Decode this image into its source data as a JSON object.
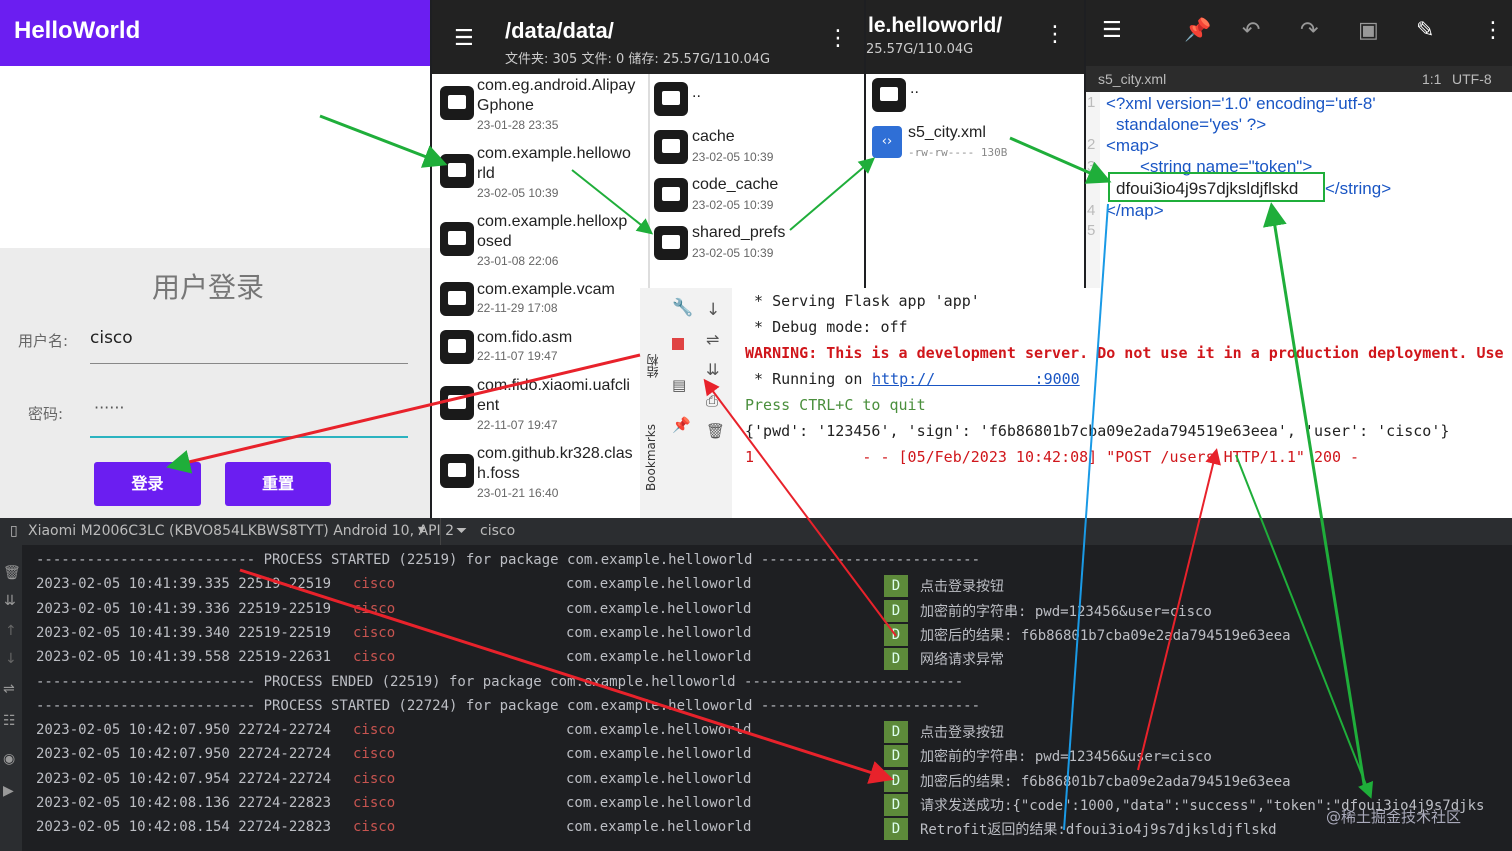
{
  "app": {
    "title": "HelloWorld",
    "login_title": "用户登录",
    "username_label": "用户名:",
    "username_value": "cisco",
    "password_label": "密码:",
    "password_value": "······",
    "login_button": "登录",
    "reset_button": "重置"
  },
  "fm": {
    "path": "/data/data/",
    "stats": "文件夹: 305  文件: 0  储存: 25.57G/110.04G",
    "items": [
      {
        "name1": "com.eg.android.Alipay",
        "name2": "Gphone",
        "date": "23-01-28 23:35"
      },
      {
        "name1": "com.example.hellowo",
        "name2": "rld",
        "date": "23-02-05 10:39"
      },
      {
        "name1": "com.example.helloxp",
        "name2": "osed",
        "date": "23-01-08 22:06"
      },
      {
        "name1": "com.example.vcam",
        "name2": "",
        "date": "22-11-29 17:08"
      },
      {
        "name1": "com.fido.asm",
        "name2": "",
        "date": "22-11-07 19:47"
      },
      {
        "name1": "com.fido.xiaomi.uafcli",
        "name2": "ent",
        "date": "22-11-07 19:47"
      },
      {
        "name1": "com.github.kr328.clas",
        "name2": "h.foss",
        "date": "23-01-21 16:40"
      }
    ],
    "dirs": [
      {
        "name": "..",
        "date": ""
      },
      {
        "name": "cache",
        "date": "23-02-05 10:39"
      },
      {
        "name": "code_cache",
        "date": "23-02-05 10:39"
      },
      {
        "name": "shared_prefs",
        "date": "23-02-05 10:39"
      }
    ]
  },
  "fm2": {
    "path": "le.helloworld/",
    "stats": "25.57G/110.04G",
    "up": "..",
    "file": "s5_city.xml",
    "file_meta": "-rw-rw----  130B"
  },
  "editor": {
    "filename": "s5_city.xml",
    "pos": "1:1",
    "encoding": "UTF-8",
    "lines": [
      "<?xml version='1.0' encoding='utf-8'",
      "standalone='yes' ?>",
      "<map>",
      "<string name=\"token\">",
      "dfoui3io4j9s7djksldjflskd",
      "</string>",
      "</map>"
    ],
    "line_numbers": [
      "1",
      "2",
      "3",
      "4",
      "5"
    ]
  },
  "terminal": {
    "lines": [
      " * Serving Flask app 'app'",
      " * Debug mode: off",
      "WARNING: This is a development server. Do not use it in a production deployment. Use",
      " * Running on ",
      "Press CTRL+C to quit",
      "{'pwd': '123456', 'sign': 'f6b86801b7cba09e2ada794519e63eea', 'user': 'cisco'}",
      "1            - - [05/Feb/2023 10:42:08] \"POST /users HTTP/1.1\" 200 -"
    ],
    "link": "http://           :9000",
    "side_labels": [
      "结构",
      "Bookmarks"
    ]
  },
  "logcat": {
    "device": "Xiaomi M2006C3LC (KBVO854LKBWS8TYT) Android 10, API 2",
    "filter": "cisco",
    "lines": [
      {
        "text": "-------------------------- PROCESS STARTED (22519) for package com.example.helloworld --------------------------",
        "kind": "sep"
      },
      {
        "ts": "2023-02-05 10:41:39.335 22519-22519",
        "tag": "cisco",
        "pkg": "com.example.helloworld",
        "lvl": "D",
        "msg": "点击登录按钮"
      },
      {
        "ts": "2023-02-05 10:41:39.336 22519-22519",
        "tag": "cisco",
        "pkg": "com.example.helloworld",
        "lvl": "D",
        "msg": "加密前的字符串: pwd=123456&user=cisco"
      },
      {
        "ts": "2023-02-05 10:41:39.340 22519-22519",
        "tag": "cisco",
        "pkg": "com.example.helloworld",
        "lvl": "D",
        "msg": "加密后的结果: f6b86801b7cba09e2ada794519e63eea"
      },
      {
        "ts": "2023-02-05 10:41:39.558 22519-22631",
        "tag": "cisco",
        "pkg": "com.example.helloworld",
        "lvl": "D",
        "msg": "网络请求异常"
      },
      {
        "text": "-------------------------- PROCESS ENDED (22519) for package com.example.helloworld --------------------------",
        "kind": "sep"
      },
      {
        "text": "-------------------------- PROCESS STARTED (22724) for package com.example.helloworld --------------------------",
        "kind": "sep"
      },
      {
        "ts": "2023-02-05 10:42:07.950 22724-22724",
        "tag": "cisco",
        "pkg": "com.example.helloworld",
        "lvl": "D",
        "msg": "点击登录按钮"
      },
      {
        "ts": "2023-02-05 10:42:07.950 22724-22724",
        "tag": "cisco",
        "pkg": "com.example.helloworld",
        "lvl": "D",
        "msg": "加密前的字符串: pwd=123456&user=cisco"
      },
      {
        "ts": "2023-02-05 10:42:07.954 22724-22724",
        "tag": "cisco",
        "pkg": "com.example.helloworld",
        "lvl": "D",
        "msg": "加密后的结果: f6b86801b7cba09e2ada794519e63eea"
      },
      {
        "ts": "2023-02-05 10:42:08.136 22724-22823",
        "tag": "cisco",
        "pkg": "com.example.helloworld",
        "lvl": "D",
        "msg": "请求发送成功:{\"code\":1000,\"data\":\"success\",\"token\":\"dfoui3io4j9s7djks"
      },
      {
        "ts": "2023-02-05 10:42:08.154 22724-22823",
        "tag": "cisco",
        "pkg": "com.example.helloworld",
        "lvl": "D",
        "msg": "Retrofit返回的结果:dfoui3io4j9s7djksldjflskd"
      }
    ]
  },
  "watermark": "@稀土掘金技术社区",
  "colors": {
    "accent": "#6b1ef1",
    "warning": "#d0161b",
    "arrow_green": "#1fae3a",
    "arrow_red": "#e8222b",
    "arrow_blue": "#1a9ae6"
  }
}
